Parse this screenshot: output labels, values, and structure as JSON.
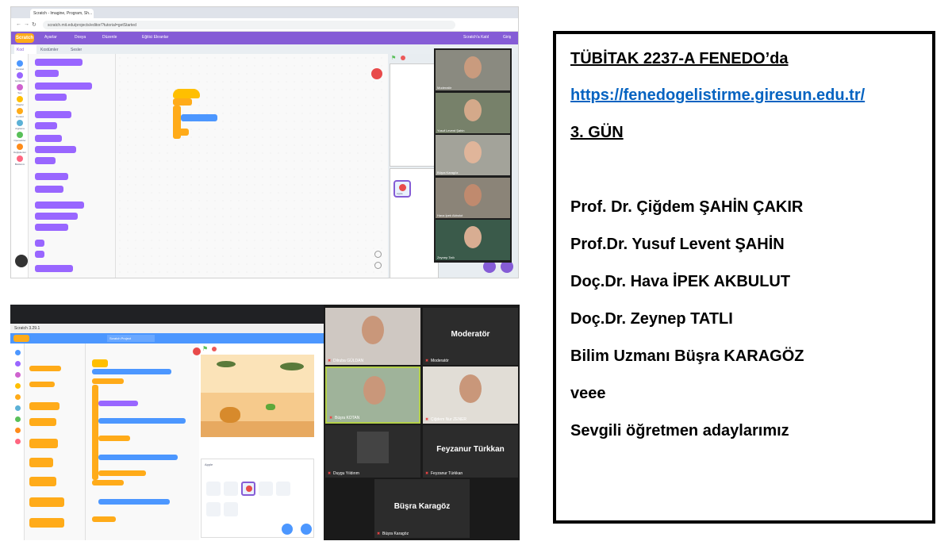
{
  "top_screenshot": {
    "browser_tab": "Scratch - Imagine, Program, Sh...",
    "url": "scratch.mit.edu/projects/editor/?tutorial=getStarted",
    "scratch_menu": {
      "logo": "Scratch",
      "items": [
        "Ayarlar",
        "Dosya",
        "Düzenle",
        "Eğitici Ekranlar"
      ],
      "user": "Scratch'a Katıl",
      "signin": "Giriş"
    },
    "editor_tabs": [
      "Kod",
      "Kostümler",
      "Sesler"
    ],
    "categories": [
      {
        "label": "Hareket",
        "color": "#4c97ff"
      },
      {
        "label": "Görünüm",
        "color": "#9966ff"
      },
      {
        "label": "Ses",
        "color": "#cf63cf"
      },
      {
        "label": "Olaylar",
        "color": "#ffbf00"
      },
      {
        "label": "Kontrol",
        "color": "#ffab19"
      },
      {
        "label": "Algılama",
        "color": "#5cb1d6"
      },
      {
        "label": "Operatörler",
        "color": "#59c059"
      },
      {
        "label": "Değişkenler",
        "color": "#ff8c1a"
      },
      {
        "label": "Bloklarım",
        "color": "#ff6680"
      }
    ],
    "sprite_label": "Apple",
    "participants": [
      {
        "name": "Moderatör"
      },
      {
        "name": "Yusuf Levent Şahin"
      },
      {
        "name": "Büşra Karagöz"
      },
      {
        "name": "Hava İpek Akbulut"
      },
      {
        "name": "Zeynep Tatlı"
      }
    ]
  },
  "bottom_screenshot": {
    "window_title": "Scratch 3.29.1",
    "project_title": "Scratch Project",
    "sprite_label": "Apple",
    "participants": [
      {
        "name": "Dilruba GÜLDAN",
        "big": ""
      },
      {
        "name": "Moderatör",
        "big": "Moderatör"
      },
      {
        "name": "Büşra KOTAN",
        "big": ""
      },
      {
        "name": "Çiğdem Nur ZENER",
        "big": ""
      },
      {
        "name": "Duygu Yıldırım",
        "big": ""
      },
      {
        "name": "Feyzanur Türkkan",
        "big": "Feyzanur Türkkan"
      },
      {
        "name": "Büşra Karagöz",
        "big": "Büşra Karagöz"
      }
    ]
  },
  "info": {
    "title": "TÜBİTAK 2237-A FENEDO’da",
    "url": "https://fenedogelistirme.giresun.edu.tr/",
    "day": "3. GÜN",
    "people": [
      "Prof. Dr. Çiğdem ŞAHİN ÇAKIR",
      "Prof.Dr. Yusuf Levent ŞAHİN",
      "Doç.Dr. Hava İPEK AKBULUT",
      "Doç.Dr. Zeynep TATLI",
      "Bilim Uzmanı Büşra KARAGÖZ"
    ],
    "conj": "veee",
    "closing": "Sevgili öğretmen adaylarımız"
  }
}
